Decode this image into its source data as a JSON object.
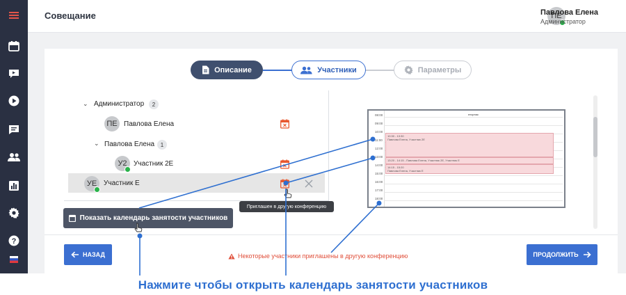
{
  "header": {
    "title": "Совещание",
    "user": {
      "initials": "ПЕ",
      "name": "Павлова Елена",
      "role": "Администратор"
    }
  },
  "sidebar": {
    "items": [
      {
        "icon": "menu-icon"
      },
      {
        "icon": "calendar-icon"
      },
      {
        "icon": "video-icon"
      },
      {
        "icon": "play-icon"
      },
      {
        "icon": "chat-icon"
      },
      {
        "icon": "users-icon"
      },
      {
        "icon": "chart-icon"
      },
      {
        "icon": "gear-icon"
      },
      {
        "icon": "help-icon"
      },
      {
        "icon": "language-flag-icon"
      }
    ]
  },
  "steps": [
    {
      "label": "Описание",
      "icon": "document-icon",
      "state": "active"
    },
    {
      "label": "Участники",
      "icon": "users-icon",
      "state": "current"
    },
    {
      "label": "Параметры",
      "icon": "gear-icon",
      "state": "disabled"
    }
  ],
  "tree": {
    "groups": [
      {
        "label": "Администратор",
        "count": "2"
      },
      {
        "label": "Павлова Елена",
        "count": "1"
      }
    ],
    "members": [
      {
        "initials": "ПЕ",
        "name": "Павлова Елена"
      },
      {
        "initials": "У2",
        "name": "Участник 2Е"
      },
      {
        "initials": "УЕ",
        "name": "Участник Е"
      }
    ]
  },
  "tooltip": "Приглашен в другую конференцию",
  "show_calendar_button": "Показать календарь занятости участников",
  "calendar_preview": {
    "day": "вторник",
    "times": [
      "08:00",
      "09:00",
      "10:00",
      "11:00",
      "12:00",
      "13:00",
      "14:00",
      "15:00",
      "16:00",
      "17:00",
      "18:00"
    ],
    "events": [
      {
        "time": "10:30 - 13:30",
        "text": "Павлова Елена, Участник 2Е"
      },
      {
        "time": "13:20 - 14:15",
        "text": "Павлова Елена, Участник 2Е, Участник Е"
      },
      {
        "time": "14:15 - 15:20",
        "text": "Павлова Елена, Участник Е"
      }
    ]
  },
  "footer": {
    "back": "НАЗАД",
    "warning": "Некоторые участники приглашены в другую конференцию",
    "continue": "ПРОДОЛЖИТЬ"
  },
  "caption": "Нажмите чтобы открыть календарь занятости участников",
  "colors": {
    "sidebar": "#2a3042",
    "accent_blue": "#3b6fd1",
    "step_active": "#3f4f6e",
    "warning_red": "#e04e39",
    "caption_blue": "#2e6fd0",
    "conflict_icon": "#e8582f",
    "online_green": "#29b34a"
  }
}
